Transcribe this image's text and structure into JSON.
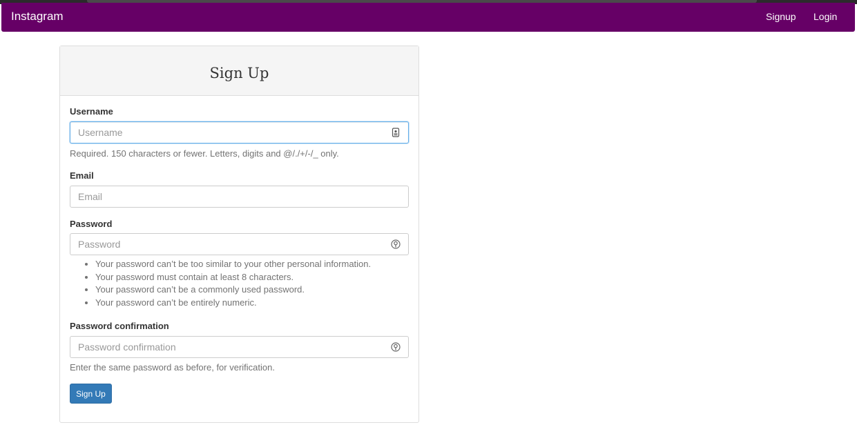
{
  "navbar": {
    "brand": "Instagram",
    "links": [
      {
        "label": "Signup"
      },
      {
        "label": "Login"
      }
    ],
    "color": "#660066"
  },
  "form": {
    "title": "Sign Up",
    "username": {
      "label": "Username",
      "placeholder": "Username",
      "value": "",
      "help": "Required. 150 characters or fewer. Letters, digits and @/./+/-/_ only.",
      "icon": "contact-card-icon"
    },
    "email": {
      "label": "Email",
      "placeholder": "Email",
      "value": ""
    },
    "password": {
      "label": "Password",
      "placeholder": "Password",
      "value": "",
      "icon": "password-key-icon",
      "rules": [
        "Your password can’t be too similar to your other personal information.",
        "Your password must contain at least 8 characters.",
        "Your password can’t be a commonly used password.",
        "Your password can’t be entirely numeric."
      ]
    },
    "password_confirmation": {
      "label": "Password confirmation",
      "placeholder": "Password confirmation",
      "value": "",
      "help": "Enter the same password as before, for verification.",
      "icon": "password-key-icon"
    },
    "submit_label": "Sign Up",
    "button_color": "#337ab7"
  }
}
